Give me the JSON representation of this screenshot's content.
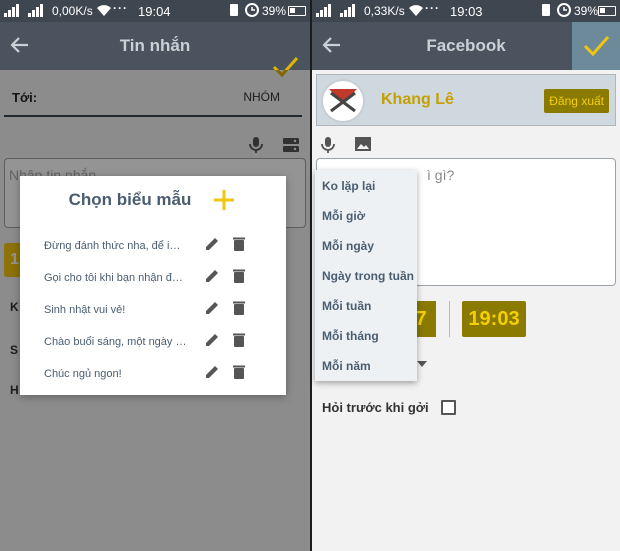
{
  "left": {
    "status": {
      "signal": "│││",
      "net": "0,00K/s",
      "time": "19:04",
      "battery_pct": "39%"
    },
    "toolbar": {
      "title": "Tin nhắn"
    },
    "to_label": "Tới:",
    "group_label": "NHÓM",
    "message_placeholder": "Nhập tin nhắn",
    "stub_digit": "1",
    "stub_labels": [
      "K",
      "S",
      "H"
    ],
    "dialog": {
      "title": "Chọn biểu mẫu",
      "templates": [
        "Đừng đánh thức nha, để im lặng",
        "Gọi cho tôi khi bạn nhận được tin",
        "Sinh nhật vui vẻ!",
        "Chào buổi sáng, một ngày tốt lành",
        "Chúc ngủ ngon!"
      ]
    }
  },
  "right": {
    "status": {
      "signal": "│││",
      "net": "0,33K/s",
      "time": "19:03",
      "battery_pct": "39%"
    },
    "toolbar": {
      "title": "Facebook"
    },
    "account": {
      "name": "Khang Lê",
      "logout_label": "Đăng xuất"
    },
    "message_placeholder": "ì gì?",
    "date_value": "7",
    "time_value": "19:03",
    "repeat_menu": [
      "Ko lặp lại",
      "Mỗi giờ",
      "Mỗi ngày",
      "Ngày trong tuần",
      "Mỗi tuần",
      "Mỗi tháng",
      "Mỗi năm"
    ],
    "ask_before_send": "Hỏi trước khi gởi"
  },
  "colors": {
    "toolbar": "#4a535e",
    "accent": "#f1c40f",
    "dark_accent": "#8a7a00"
  }
}
